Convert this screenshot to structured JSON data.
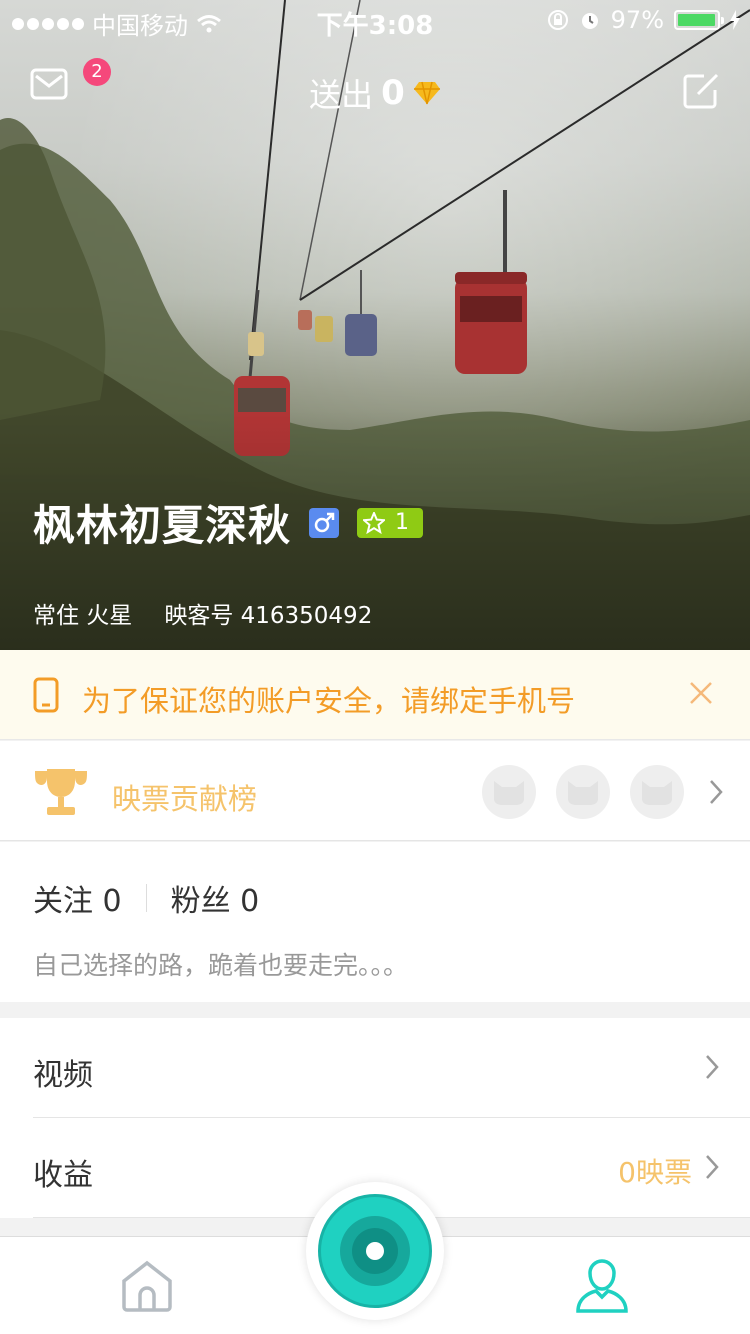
{
  "status_bar": {
    "carrier": "中国移动",
    "time": "下午3:08",
    "battery": "97%",
    "battery_level": 0.97
  },
  "header": {
    "mail_badge": "2",
    "sent_label": "送出",
    "sent_count": "0"
  },
  "profile": {
    "name": "枫林初夏深秋",
    "level": "1",
    "location": "常住 火星",
    "id_text": "映客号 416350492"
  },
  "banner": {
    "text": "为了保证您的账户安全，请绑定手机号"
  },
  "contribution": {
    "label": "映票贡献榜"
  },
  "follow": {
    "following": "关注 0",
    "fans": "粉丝 0",
    "bio": "自己选择的路，跪着也要走完。。。"
  },
  "list": [
    {
      "title": "视频",
      "value": ""
    },
    {
      "title": "收益",
      "value": "0映票"
    }
  ],
  "colors": {
    "accent": "#1fd1c1",
    "gold": "#f5c36b",
    "warning": "#f39c27",
    "badge": "#f5487b",
    "level": "#8fcb14",
    "gender": "#5a8bef"
  }
}
